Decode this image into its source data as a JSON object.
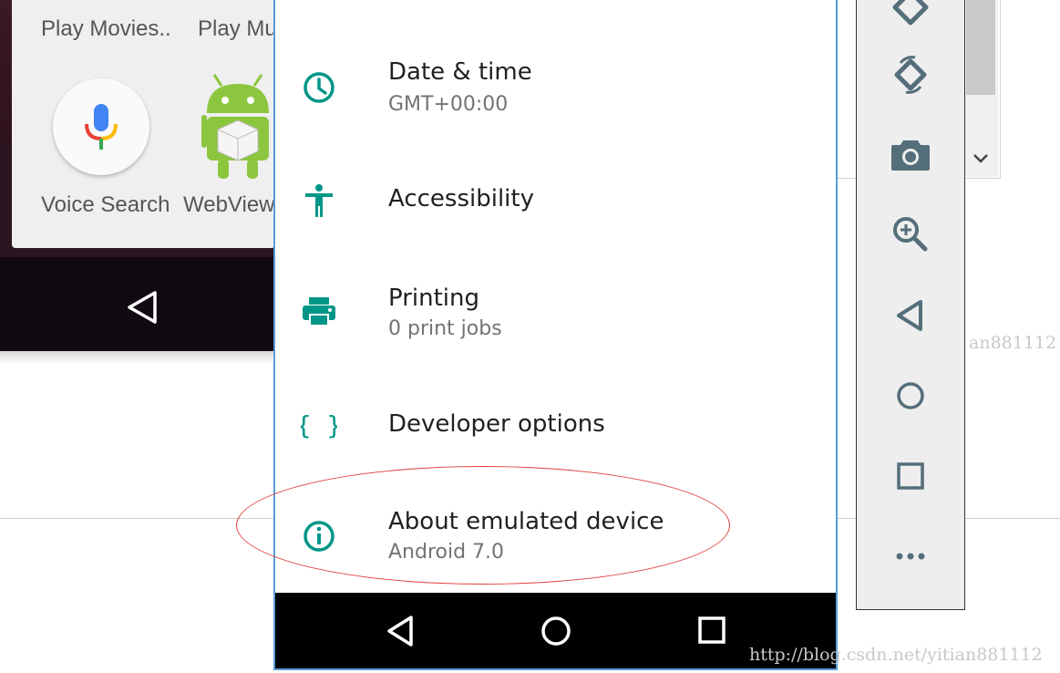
{
  "background_window": {
    "apps_row1": [
      "Play Movies..",
      "Play Mus"
    ],
    "apps_row2": [
      "Voice Search",
      "WebView"
    ]
  },
  "settings": {
    "items": [
      {
        "title": "Date & time",
        "subtitle": "GMT+00:00",
        "icon": "clock-icon"
      },
      {
        "title": "Accessibility",
        "subtitle": "",
        "icon": "accessibility-icon"
      },
      {
        "title": "Printing",
        "subtitle": "0 print jobs",
        "icon": "printer-icon"
      },
      {
        "title": "Developer options",
        "subtitle": "",
        "icon": "braces-icon"
      },
      {
        "title": "About emulated device",
        "subtitle": "Android 7.0",
        "icon": "info-icon"
      }
    ]
  },
  "toolbar": {
    "buttons": [
      "rotate-left-icon",
      "rotate-right-icon",
      "camera-icon",
      "zoom-in-icon",
      "back-icon",
      "home-icon",
      "overview-icon",
      "more-icon"
    ]
  },
  "colors": {
    "accent": "#009688",
    "toolbar_icon": "#546e7a",
    "annotation": "#e04040",
    "phone_border": "#5a9bd8"
  },
  "watermark": {
    "partial": "an881112",
    "full": "http://blog.csdn.net/yitian881112"
  }
}
